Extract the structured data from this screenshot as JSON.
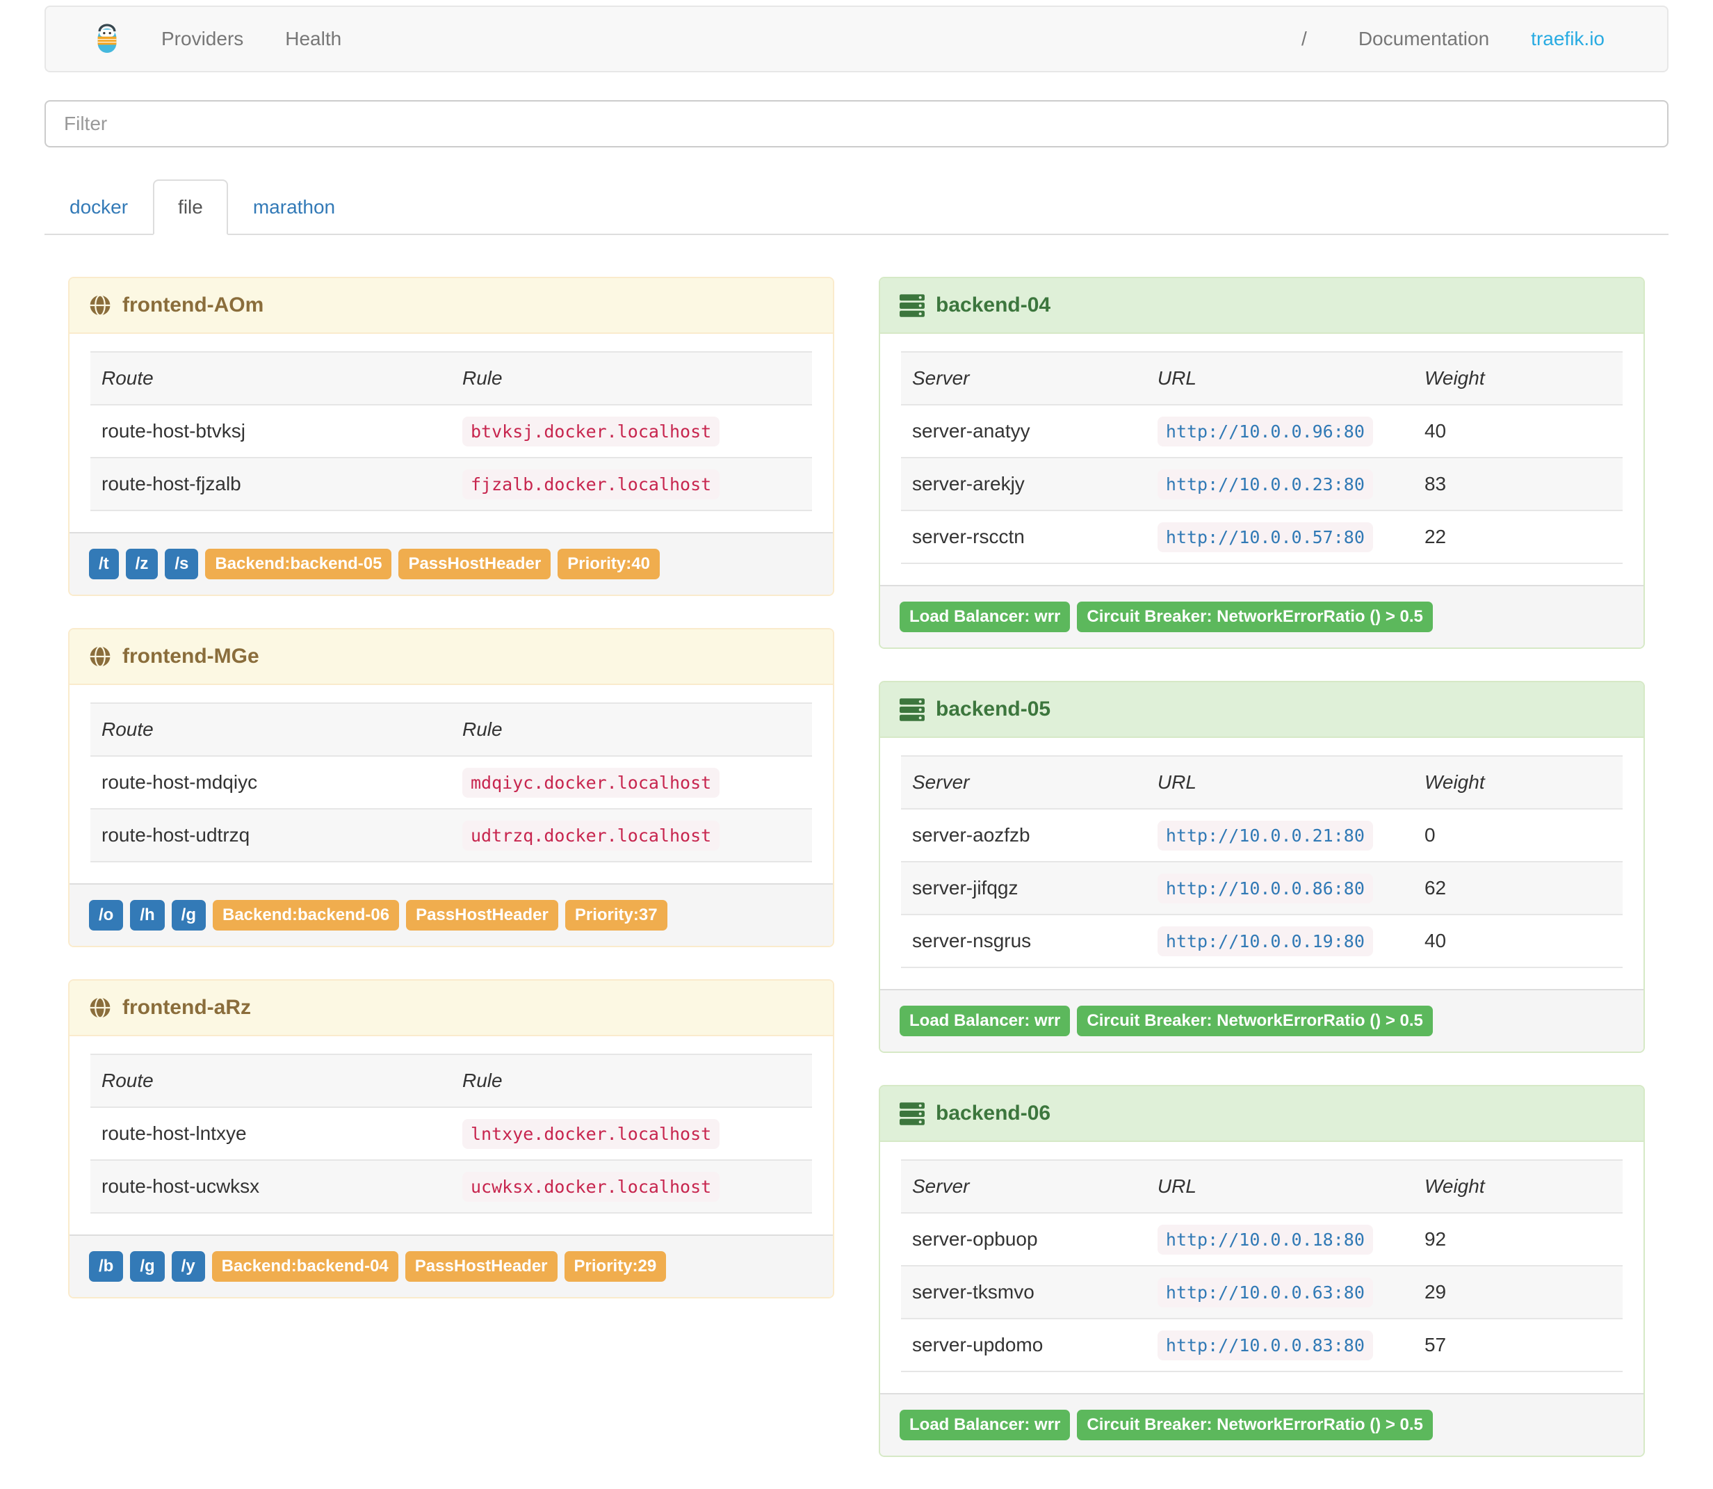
{
  "navbar": {
    "links": [
      "Providers",
      "Health"
    ],
    "separator": "/",
    "doc_link": "Documentation",
    "site_link": "traefik.io"
  },
  "filter": {
    "placeholder": "Filter"
  },
  "tabs": [
    "docker",
    "file",
    "marathon"
  ],
  "active_tab": "file",
  "frontends": [
    {
      "title": "frontend-AOm",
      "columns": [
        "Route",
        "Rule"
      ],
      "routes": [
        {
          "name": "route-host-btvksj",
          "rule": "btvksj.docker.localhost"
        },
        {
          "name": "route-host-fjzalb",
          "rule": "fjzalb.docker.localhost"
        }
      ],
      "entry_labels": [
        "/t",
        "/z",
        "/s"
      ],
      "backend_label": "Backend:backend-05",
      "pass_label": "PassHostHeader",
      "priority_label": "Priority:40"
    },
    {
      "title": "frontend-MGe",
      "columns": [
        "Route",
        "Rule"
      ],
      "routes": [
        {
          "name": "route-host-mdqiyc",
          "rule": "mdqiyc.docker.localhost"
        },
        {
          "name": "route-host-udtrzq",
          "rule": "udtrzq.docker.localhost"
        }
      ],
      "entry_labels": [
        "/o",
        "/h",
        "/g"
      ],
      "backend_label": "Backend:backend-06",
      "pass_label": "PassHostHeader",
      "priority_label": "Priority:37"
    },
    {
      "title": "frontend-aRz",
      "columns": [
        "Route",
        "Rule"
      ],
      "routes": [
        {
          "name": "route-host-lntxye",
          "rule": "lntxye.docker.localhost"
        },
        {
          "name": "route-host-ucwksx",
          "rule": "ucwksx.docker.localhost"
        }
      ],
      "entry_labels": [
        "/b",
        "/g",
        "/y"
      ],
      "backend_label": "Backend:backend-04",
      "pass_label": "PassHostHeader",
      "priority_label": "Priority:29"
    }
  ],
  "backends": [
    {
      "title": "backend-04",
      "columns": [
        "Server",
        "URL",
        "Weight"
      ],
      "servers": [
        {
          "name": "server-anatyy",
          "url": "http://10.0.0.96:80",
          "weight": "40"
        },
        {
          "name": "server-arekjy",
          "url": "http://10.0.0.23:80",
          "weight": "83"
        },
        {
          "name": "server-rscctn",
          "url": "http://10.0.0.57:80",
          "weight": "22"
        }
      ],
      "lb_label": "Load Balancer: wrr",
      "cb_label": "Circuit Breaker: NetworkErrorRatio () > 0.5"
    },
    {
      "title": "backend-05",
      "columns": [
        "Server",
        "URL",
        "Weight"
      ],
      "servers": [
        {
          "name": "server-aozfzb",
          "url": "http://10.0.0.21:80",
          "weight": "0"
        },
        {
          "name": "server-jifqgz",
          "url": "http://10.0.0.86:80",
          "weight": "62"
        },
        {
          "name": "server-nsgrus",
          "url": "http://10.0.0.19:80",
          "weight": "40"
        }
      ],
      "lb_label": "Load Balancer: wrr",
      "cb_label": "Circuit Breaker: NetworkErrorRatio () > 0.5"
    },
    {
      "title": "backend-06",
      "columns": [
        "Server",
        "URL",
        "Weight"
      ],
      "servers": [
        {
          "name": "server-opbuop",
          "url": "http://10.0.0.18:80",
          "weight": "92"
        },
        {
          "name": "server-tksmvo",
          "url": "http://10.0.0.63:80",
          "weight": "29"
        },
        {
          "name": "server-updomo",
          "url": "http://10.0.0.83:80",
          "weight": "57"
        }
      ],
      "lb_label": "Load Balancer: wrr",
      "cb_label": "Circuit Breaker: NetworkErrorRatio () > 0.5"
    }
  ],
  "colors": {
    "site_link_blue": "#29abe2",
    "tab_link_blue": "#337ab7",
    "frontend_heading_bg": "#fcf8e3",
    "frontend_heading_text": "#8a6d3b",
    "backend_heading_bg": "#dff0d8",
    "backend_heading_text": "#3c763d",
    "rule_code_text": "#c7254e",
    "url_code_text": "#3079b5",
    "code_bg": "#f9f2f4",
    "label_blue": "#337ab7",
    "label_orange": "#f0ad4e",
    "label_green": "#5cb85c"
  }
}
